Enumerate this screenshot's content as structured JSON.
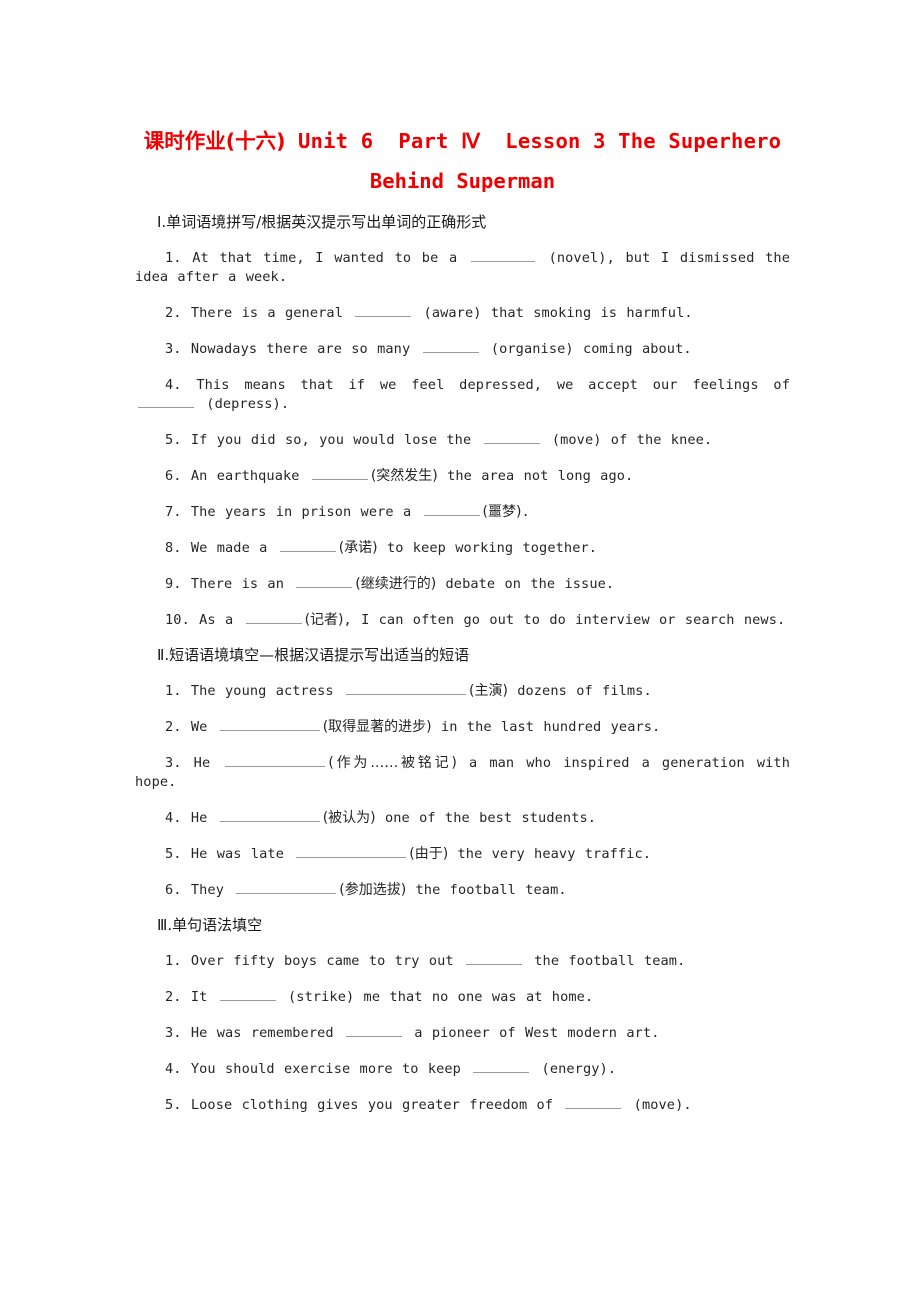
{
  "title": {
    "line1_cjk": "课时作业(十六)",
    "line1_gap": " ",
    "line1_en": "Unit 6  Part Ⅳ  Lesson 3 The Superhero",
    "line2_prefix": "Behind ",
    "line2_italic": "Superman",
    "color": "#ef0000"
  },
  "sections": [
    {
      "heading": "Ⅰ.单词语境拼写/根据英汉提示写出单词的正确形式",
      "items": [
        {
          "num": "1.",
          "parts": [
            {
              "t": "text",
              "v": " At that time, I wanted to be a "
            },
            {
              "t": "blank",
              "w": "w1"
            },
            {
              "t": "text",
              "v": " (novel), but I dismissed the idea after a week."
            }
          ]
        },
        {
          "num": "2.",
          "parts": [
            {
              "t": "text",
              "v": " There is a general "
            },
            {
              "t": "blank",
              "w": "w2"
            },
            {
              "t": "text",
              "v": " (aware) that smoking is harmful."
            }
          ]
        },
        {
          "num": "3.",
          "parts": [
            {
              "t": "text",
              "v": " Nowadays there are so many "
            },
            {
              "t": "blank",
              "w": "w2"
            },
            {
              "t": "text",
              "v": " (organise) coming about."
            }
          ]
        },
        {
          "num": "4.",
          "parts": [
            {
              "t": "text",
              "v": " This means that if we feel depressed, we accept our feelings of "
            },
            {
              "t": "blank",
              "w": "w2"
            },
            {
              "t": "text",
              "v": " (depress)."
            }
          ]
        },
        {
          "num": "5.",
          "parts": [
            {
              "t": "text",
              "v": " If you did so, you would lose the "
            },
            {
              "t": "blank",
              "w": "w2"
            },
            {
              "t": "text",
              "v": " (move) of the knee."
            }
          ]
        },
        {
          "num": "6.",
          "parts": [
            {
              "t": "text",
              "v": " An earthquake "
            },
            {
              "t": "blank",
              "w": "w2"
            },
            {
              "t": "cjk",
              "v": "(突然发生)"
            },
            {
              "t": "text",
              "v": " the area not long ago."
            }
          ]
        },
        {
          "num": "7.",
          "parts": [
            {
              "t": "text",
              "v": " The years in prison were a "
            },
            {
              "t": "blank",
              "w": "w2"
            },
            {
              "t": "cjk",
              "v": "(噩梦)"
            },
            {
              "t": "text",
              "v": "."
            }
          ]
        },
        {
          "num": "8.",
          "parts": [
            {
              "t": "text",
              "v": " We made a "
            },
            {
              "t": "blank",
              "w": "w2"
            },
            {
              "t": "cjk",
              "v": "(承诺)"
            },
            {
              "t": "text",
              "v": " to keep working together."
            }
          ]
        },
        {
          "num": "9.",
          "parts": [
            {
              "t": "text",
              "v": " There is an "
            },
            {
              "t": "blank",
              "w": "w2"
            },
            {
              "t": "cjk",
              "v": "(继续进行的)"
            },
            {
              "t": "text",
              "v": " debate on the issue."
            }
          ]
        },
        {
          "num": "10.",
          "parts": [
            {
              "t": "text",
              "v": " As a "
            },
            {
              "t": "blank",
              "w": "w2"
            },
            {
              "t": "cjk",
              "v": "(记者)"
            },
            {
              "t": "text",
              "v": ", I can often go out to do interview or search news."
            }
          ]
        }
      ]
    },
    {
      "heading": "Ⅱ.短语语境填空—根据汉语提示写出适当的短语",
      "items": [
        {
          "num": "1.",
          "parts": [
            {
              "t": "text",
              "v": " The young actress "
            },
            {
              "t": "blank",
              "w": "w3"
            },
            {
              "t": "cjk",
              "v": "(主演)"
            },
            {
              "t": "text",
              "v": " dozens of films."
            }
          ]
        },
        {
          "num": "2.",
          "parts": [
            {
              "t": "text",
              "v": " We "
            },
            {
              "t": "blank",
              "w": "w4"
            },
            {
              "t": "cjk",
              "v": "(取得显著的进步)"
            },
            {
              "t": "text",
              "v": " in the last hundred years."
            }
          ]
        },
        {
          "num": "3.",
          "parts": [
            {
              "t": "text",
              "v": " He "
            },
            {
              "t": "blank",
              "w": "w4"
            },
            {
              "t": "cjk",
              "v": "(作为……被铭记)"
            },
            {
              "t": "text",
              "v": " a man who inspired a generation with hope."
            }
          ]
        },
        {
          "num": "4.",
          "parts": [
            {
              "t": "text",
              "v": " He "
            },
            {
              "t": "blank",
              "w": "w4"
            },
            {
              "t": "cjk",
              "v": "(被认为)"
            },
            {
              "t": "text",
              "v": " one of the best students."
            }
          ]
        },
        {
          "num": "5.",
          "parts": [
            {
              "t": "text",
              "v": " He was late "
            },
            {
              "t": "blank",
              "w": "w5"
            },
            {
              "t": "cjk",
              "v": "(由于)"
            },
            {
              "t": "text",
              "v": " the very heavy traffic."
            }
          ]
        },
        {
          "num": "6.",
          "parts": [
            {
              "t": "text",
              "v": " They "
            },
            {
              "t": "blank",
              "w": "w4"
            },
            {
              "t": "cjk",
              "v": "(参加选拔)"
            },
            {
              "t": "text",
              "v": " the football team."
            }
          ]
        }
      ]
    },
    {
      "heading": "Ⅲ.单句语法填空",
      "items": [
        {
          "num": "1.",
          "parts": [
            {
              "t": "text",
              "v": " Over fifty boys came to try out "
            },
            {
              "t": "blank",
              "w": "w2"
            },
            {
              "t": "text",
              "v": " the football team."
            }
          ]
        },
        {
          "num": "2.",
          "parts": [
            {
              "t": "text",
              "v": " It "
            },
            {
              "t": "blank",
              "w": "w2"
            },
            {
              "t": "text",
              "v": " (strike) me that no one was at home."
            }
          ]
        },
        {
          "num": "3.",
          "parts": [
            {
              "t": "text",
              "v": " He was remembered "
            },
            {
              "t": "blank",
              "w": "w2"
            },
            {
              "t": "text",
              "v": " a pioneer of West modern art."
            }
          ]
        },
        {
          "num": "4.",
          "parts": [
            {
              "t": "text",
              "v": " You should exercise more to keep "
            },
            {
              "t": "blank",
              "w": "w2"
            },
            {
              "t": "text",
              "v": " (energy)."
            }
          ]
        },
        {
          "num": "5.",
          "parts": [
            {
              "t": "text",
              "v": " Loose clothing gives you greater freedom of "
            },
            {
              "t": "blank",
              "w": "w2"
            },
            {
              "t": "text",
              "v": " (move)."
            }
          ]
        }
      ]
    }
  ]
}
